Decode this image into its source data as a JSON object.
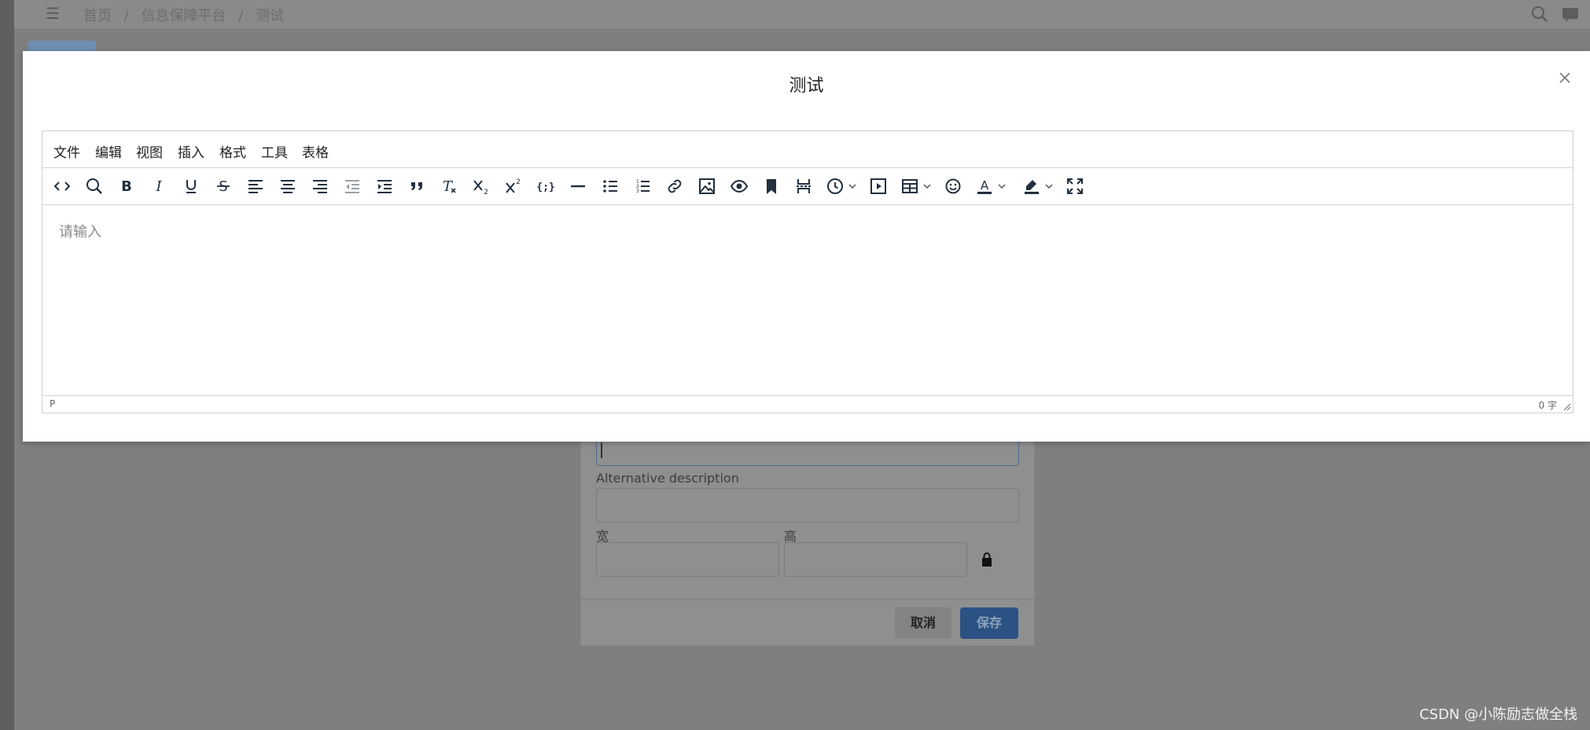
{
  "background": {
    "breadcrumb": [
      "首页",
      "/",
      "信息保障平台",
      "/",
      "测试"
    ],
    "image_dialog": {
      "alt_label": "Alternative description",
      "width_label": "宽",
      "height_label": "高",
      "cancel_label": "取消",
      "save_label": "保存"
    },
    "watermark": "CSDN @小陈励志做全栈"
  },
  "modal": {
    "title": "测试"
  },
  "editor": {
    "menus": [
      "文件",
      "编辑",
      "视图",
      "插入",
      "格式",
      "工具",
      "表格"
    ],
    "toolbar_icons": [
      "code",
      "search",
      "bold",
      "italic",
      "underline",
      "strikethrough",
      "align-left",
      "align-center",
      "align-right",
      "outdent",
      "indent",
      "blockquote",
      "remove-format",
      "subscript",
      "superscript",
      "code-sample",
      "horizontal-rule",
      "bullet-list",
      "numbered-list",
      "link",
      "image",
      "preview",
      "anchor",
      "page-break",
      "insert-datetime",
      "media",
      "table",
      "emoticons",
      "forecolor",
      "backcolor",
      "fullscreen"
    ],
    "placeholder": "请输入",
    "status_path": "P",
    "word_count": "0 字"
  },
  "colors": {
    "save_button": "#2a5283",
    "toolbar_icon": "#222f3e"
  }
}
